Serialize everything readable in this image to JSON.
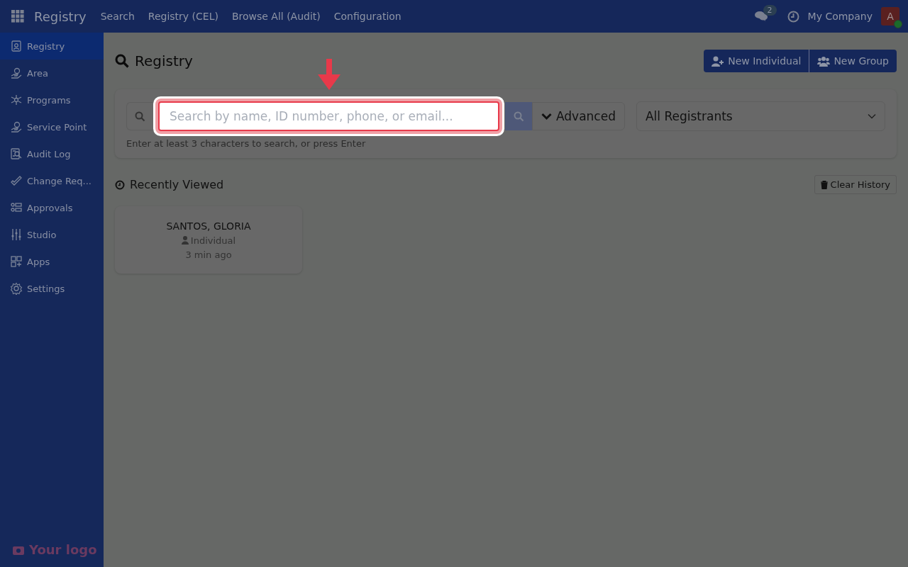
{
  "topbar": {
    "app_title": "Registry",
    "nav": [
      "Search",
      "Registry (CEL)",
      "Browse All (Audit)",
      "Configuration"
    ],
    "messages_count": "2",
    "company": "My Company",
    "avatar": {
      "initial": "A",
      "online": true
    }
  },
  "sidebar": {
    "items": [
      {
        "label": "Registry",
        "selected": true
      },
      {
        "label": "Area",
        "selected": false
      },
      {
        "label": "Programs",
        "selected": false
      },
      {
        "label": "Service Point",
        "selected": false
      },
      {
        "label": "Audit Log",
        "selected": false
      },
      {
        "label": "Change Req...",
        "selected": false
      },
      {
        "label": "Approvals",
        "selected": false
      },
      {
        "label": "Studio",
        "selected": false
      },
      {
        "label": "Apps",
        "selected": false
      },
      {
        "label": "Settings",
        "selected": false
      }
    ],
    "logo": "Your logo"
  },
  "page": {
    "title": "Registry",
    "buttons": [
      "New Individual",
      "New Group"
    ]
  },
  "search": {
    "placeholder": "Search by name, ID number, phone, or email...",
    "advanced": "Advanced",
    "filter": "All Registrants",
    "hint": "Enter at least 3 characters to search, or press Enter",
    "highlighted": true
  },
  "recent": {
    "title": "Recently Viewed",
    "clear": "Clear History",
    "cards": [
      {
        "name": "SANTOS, GLORIA",
        "type": "Individual",
        "time": "3 min ago"
      }
    ]
  }
}
